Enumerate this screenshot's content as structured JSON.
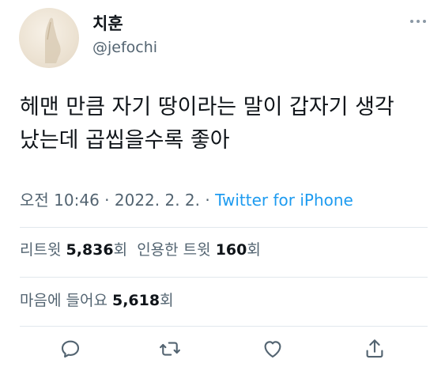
{
  "tweet": {
    "display_name": "치훈",
    "handle": "@jefochi",
    "text_line1": "헤맨 만큼 자기 땅이라는 말이 갑자기 생각",
    "text_line2": "났는데 곱씹을수록 좋아",
    "time": "오전 10:46",
    "separator1": " · ",
    "date": "2022. 2. 2.",
    "separator2": " · ",
    "source": "Twitter for iPhone"
  },
  "stats": {
    "retweets_label": "리트윗",
    "retweets_count": "5,836",
    "retweets_unit": "회",
    "quotes_label": "인용한 트윗",
    "quotes_count": "160",
    "quotes_unit": "회",
    "likes_label": "마음에 들어요",
    "likes_count": "5,618",
    "likes_unit": "회"
  },
  "icons": {
    "more": "more-horizontal-icon",
    "reply": "reply-icon",
    "retweet": "retweet-icon",
    "like": "heart-icon",
    "share": "share-icon"
  },
  "colors": {
    "text": "#0f1419",
    "secondary": "#536471",
    "link": "#1d9bf0",
    "divider": "#e1e8ed"
  }
}
